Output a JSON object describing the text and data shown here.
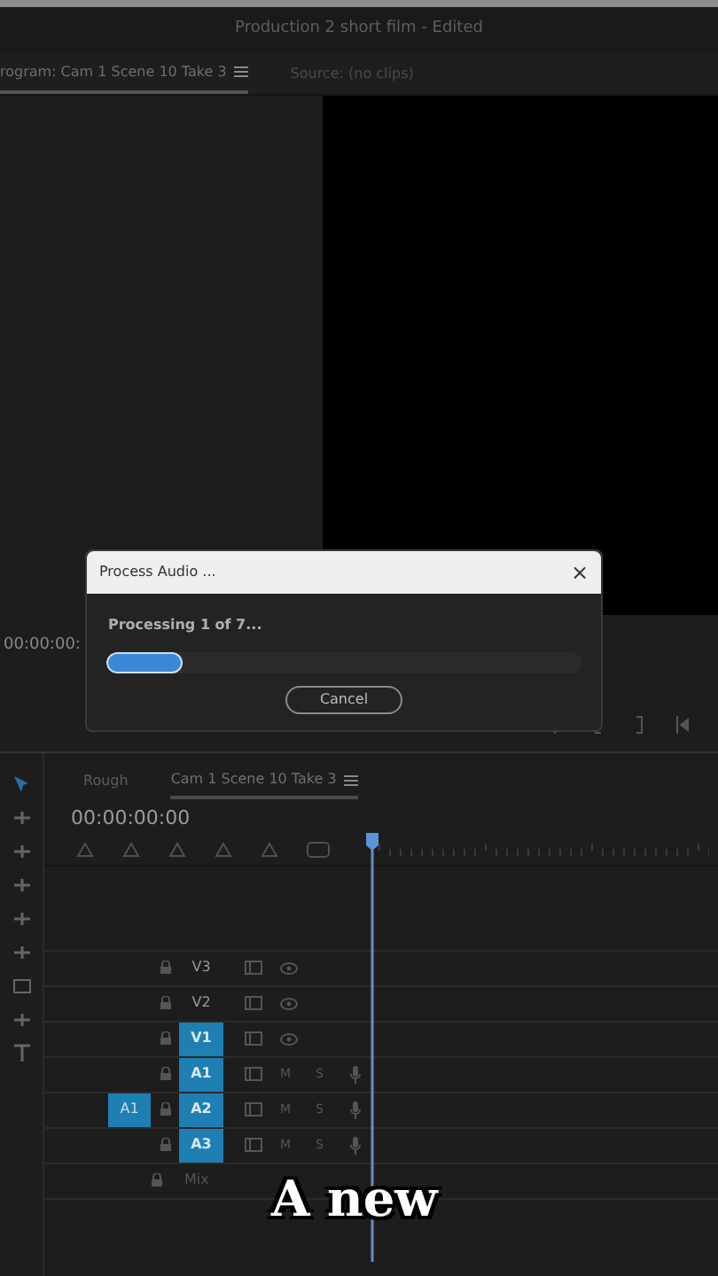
{
  "window": {
    "title": "Production 2 short film - Edited"
  },
  "monitor_tabs": [
    {
      "label": "rogram: Cam 1 Scene 10 Take 3",
      "selected": true,
      "menu": true
    },
    {
      "label": "Source: (no clips)",
      "selected": false,
      "menu": false
    }
  ],
  "program_timecode": "00:00:00:",
  "dialog": {
    "title": "Process Audio ...",
    "close": "×",
    "status": "Processing 1 of 7...",
    "level": 0.16,
    "button": "Cancel"
  },
  "timeline_tabs": [
    {
      "label": "Rough",
      "selected": false,
      "menu": false
    },
    {
      "label": "Cam 1 Scene 10 Take 3",
      "selected": true,
      "menu": true
    }
  ],
  "timeline_timecode": "00:00:00:00",
  "tracks": [
    {
      "kind": "video",
      "label": "V3",
      "targeted": false
    },
    {
      "kind": "video",
      "label": "V2",
      "targeted": false
    },
    {
      "kind": "video",
      "label": "V1",
      "targeted": true
    },
    {
      "kind": "audio",
      "label": "A1",
      "targeted": true,
      "m": "M",
      "s": "S"
    },
    {
      "kind": "audio",
      "label": "A2",
      "targeted": true,
      "source": "A1",
      "m": "M",
      "s": "S"
    },
    {
      "kind": "audio",
      "label": "A3",
      "targeted": true,
      "m": "M",
      "s": "S"
    },
    {
      "kind": "mix",
      "label": "Mix"
    }
  ],
  "caption": "A new"
}
